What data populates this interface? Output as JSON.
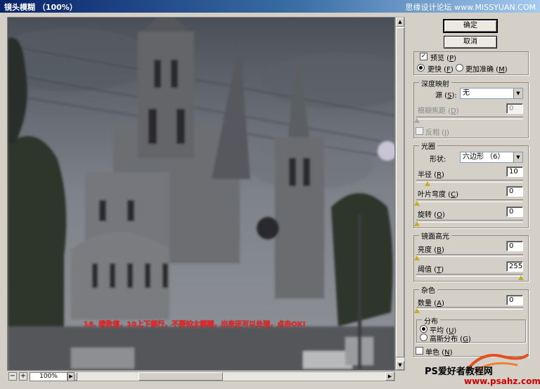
{
  "window": {
    "title": "镜头模糊 （100%）",
    "watermark": "思缘设计论坛 www.MISSYUAN.COM"
  },
  "preview": {
    "annotation": "16. 看数值，10上下都行，不要怕太模糊，出来还可以处理，点击OK!",
    "zoom": "100%",
    "zoom_minus": "−",
    "zoom_plus": "+"
  },
  "buttons": {
    "ok": "确定",
    "cancel": "取消"
  },
  "preview_opts": {
    "preview_label": "预览",
    "preview_key": "P",
    "preview_checked": true,
    "faster_label": "更快",
    "faster_key": "F",
    "accurate_label": "更加准确",
    "accurate_key": "M",
    "selected": "faster"
  },
  "depth_map": {
    "title": "深度映射",
    "source_label": "源",
    "source_key": "S",
    "source_value": "无",
    "blur_focal_label": "模糊焦距",
    "blur_focal_key": "D",
    "blur_focal_value": "0",
    "invert_label": "反相",
    "invert_key": "I",
    "invert_checked": false
  },
  "iris": {
    "title": "光圈",
    "shape_label": "形状",
    "shape_value": "六边形 （6）",
    "radius_label": "半径",
    "radius_key": "R",
    "radius_value": "10",
    "radius_level": 0.1,
    "curvature_label": "叶片弯度",
    "curvature_key": "C",
    "curvature_value": "0",
    "curvature_level": 0,
    "rotation_label": "旋转",
    "rotation_key": "O",
    "rotation_value": "0",
    "rotation_level": 0
  },
  "specular": {
    "title": "镜面高光",
    "brightness_label": "亮度",
    "brightness_key": "B",
    "brightness_value": "0",
    "brightness_level": 0,
    "threshold_label": "阈值",
    "threshold_key": "T",
    "threshold_value": "255",
    "threshold_level": 1
  },
  "noise": {
    "title": "杂色",
    "amount_label": "数量",
    "amount_key": "A",
    "amount_value": "0",
    "amount_level": 0,
    "dist_title": "分布",
    "uniform_label": "平均",
    "uniform_key": "U",
    "gaussian_label": "高斯分布",
    "gaussian_key": "G",
    "selected": "uniform",
    "mono_label": "单色",
    "mono_key": "N",
    "mono_checked": false
  },
  "footer": {
    "watermark": "PS爱好者教程网",
    "url": "www.psahz.com"
  }
}
